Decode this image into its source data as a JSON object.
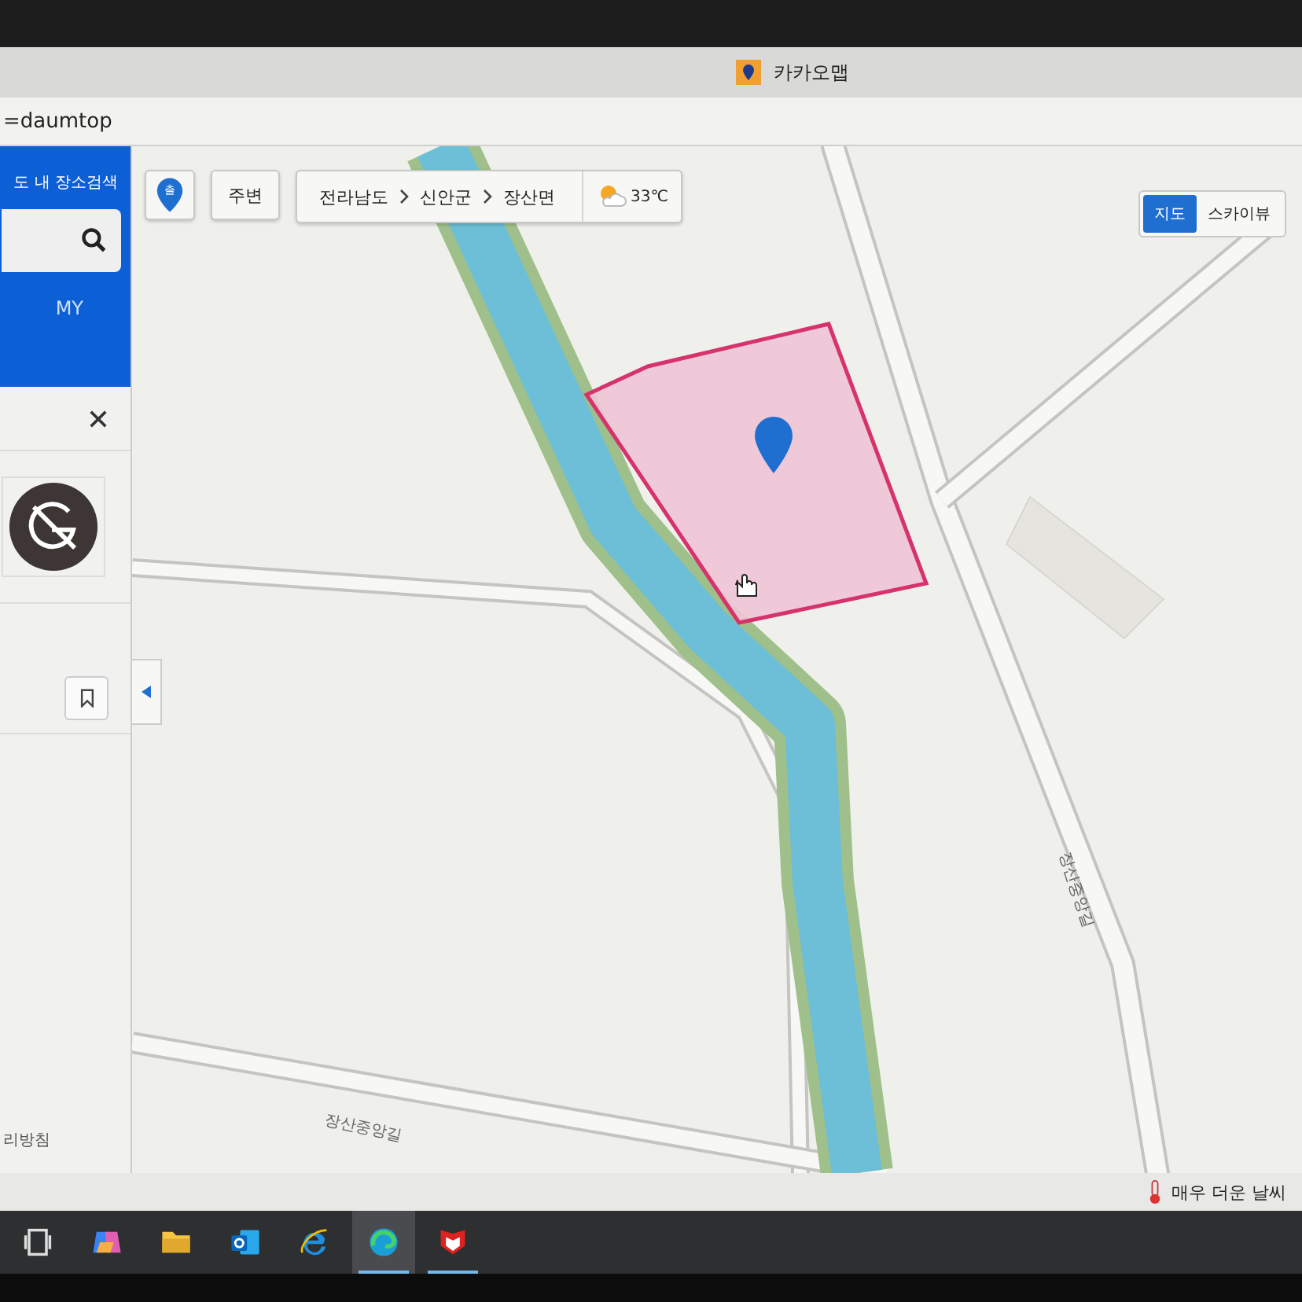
{
  "window": {
    "title": "카카오맵"
  },
  "address_bar": {
    "url": "=daumtop"
  },
  "sidebar": {
    "search_label": "도 내 장소검색",
    "my_tab": "MY",
    "footer": "리방침"
  },
  "map": {
    "pin_label": "출",
    "nearby_button": "주변",
    "breadcrumb": [
      "전라남도",
      "신안군",
      "장산면"
    ],
    "weather": "33℃",
    "view_toggle": [
      {
        "label": "지도",
        "selected": true
      },
      {
        "label": "스카이뷰",
        "selected": false
      }
    ],
    "road_labels": [
      "장산중앙길",
      "장산중앙길"
    ]
  },
  "weather_widget": {
    "text": "매우 더운 날씨"
  },
  "taskbar": {
    "apps": [
      {
        "kind": "taskview",
        "selected": false,
        "running": false
      },
      {
        "kind": "copilot",
        "selected": false,
        "running": false
      },
      {
        "kind": "folder",
        "selected": false,
        "running": false
      },
      {
        "kind": "mail",
        "selected": false,
        "running": false
      },
      {
        "kind": "ie",
        "selected": false,
        "running": false
      },
      {
        "kind": "edge",
        "selected": true,
        "running": true
      },
      {
        "kind": "shield",
        "selected": false,
        "running": true
      }
    ]
  }
}
